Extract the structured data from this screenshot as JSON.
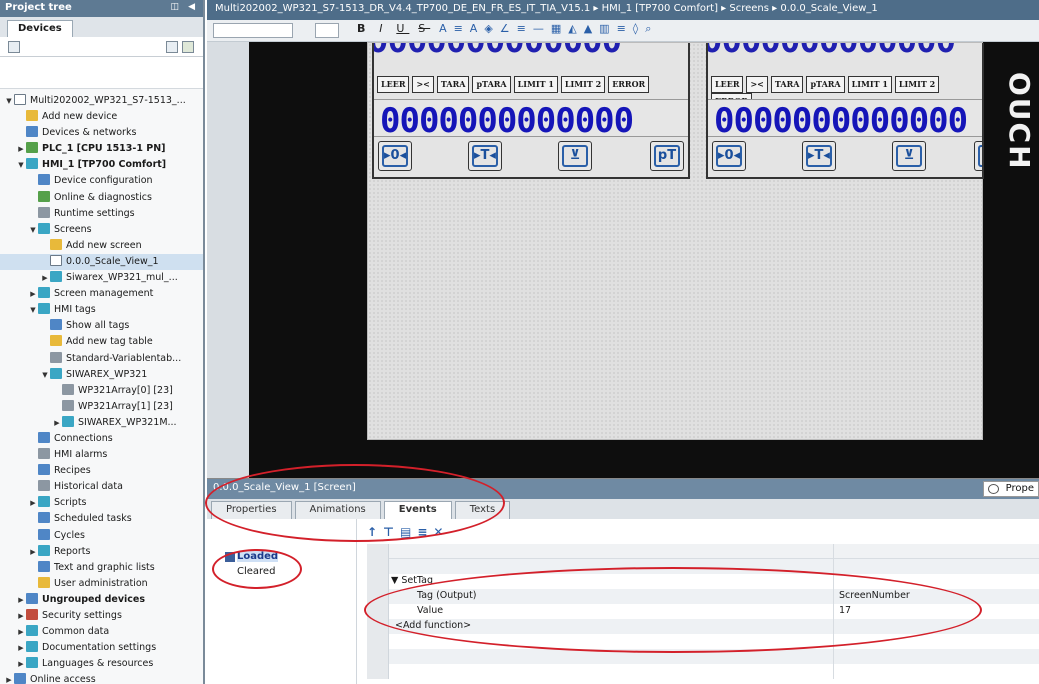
{
  "project_tree": {
    "title": "Project tree",
    "devices_tab": "Devices",
    "items": [
      {
        "label": "Multi202002_WP321_S7-1513_...",
        "indent": 0,
        "arrow": "▼",
        "icon": "doc"
      },
      {
        "label": "Add new device",
        "indent": 1,
        "arrow": "",
        "icon": "yel"
      },
      {
        "label": "Devices & networks",
        "indent": 1,
        "arrow": "",
        "icon": "blu"
      },
      {
        "label": "PLC_1 [CPU 1513-1 PN]",
        "indent": 1,
        "arrow": "▶",
        "icon": "grn",
        "bold": true
      },
      {
        "label": "HMI_1 [TP700 Comfort]",
        "indent": 1,
        "arrow": "▼",
        "icon": "cyn",
        "bold": true
      },
      {
        "label": "Device configuration",
        "indent": 2,
        "arrow": "",
        "icon": "blu"
      },
      {
        "label": "Online & diagnostics",
        "indent": 2,
        "arrow": "",
        "icon": "grn"
      },
      {
        "label": "Runtime settings",
        "indent": 2,
        "arrow": "",
        "icon": "gry"
      },
      {
        "label": "Screens",
        "indent": 2,
        "arrow": "▼",
        "icon": "cyn"
      },
      {
        "label": "Add new screen",
        "indent": 3,
        "arrow": "",
        "icon": "yel"
      },
      {
        "label": "0.0.0_Scale_View_1",
        "indent": 3,
        "arrow": "",
        "icon": "doc",
        "selected": true
      },
      {
        "label": "Siwarex_WP321_mul_...",
        "indent": 3,
        "arrow": "▶",
        "icon": "cyn"
      },
      {
        "label": "Screen management",
        "indent": 2,
        "arrow": "▶",
        "icon": "cyn"
      },
      {
        "label": "HMI tags",
        "indent": 2,
        "arrow": "▼",
        "icon": "cyn"
      },
      {
        "label": "Show all tags",
        "indent": 3,
        "arrow": "",
        "icon": "blu"
      },
      {
        "label": "Add new tag table",
        "indent": 3,
        "arrow": "",
        "icon": "yel"
      },
      {
        "label": "Standard-Variablentab...",
        "indent": 3,
        "arrow": "",
        "icon": "gry"
      },
      {
        "label": "SIWAREX_WP321",
        "indent": 3,
        "arrow": "▼",
        "icon": "cyn"
      },
      {
        "label": "WP321Array[0] [23]",
        "indent": 4,
        "arrow": "",
        "icon": "gry"
      },
      {
        "label": "WP321Array[1] [23]",
        "indent": 4,
        "arrow": "",
        "icon": "gry"
      },
      {
        "label": "SIWAREX_WP321M...",
        "indent": 4,
        "arrow": "▶",
        "icon": "cyn"
      },
      {
        "label": "Connections",
        "indent": 2,
        "arrow": "",
        "icon": "blu"
      },
      {
        "label": "HMI alarms",
        "indent": 2,
        "arrow": "",
        "icon": "gry"
      },
      {
        "label": "Recipes",
        "indent": 2,
        "arrow": "",
        "icon": "blu"
      },
      {
        "label": "Historical data",
        "indent": 2,
        "arrow": "",
        "icon": "gry"
      },
      {
        "label": "Scripts",
        "indent": 2,
        "arrow": "▶",
        "icon": "cyn"
      },
      {
        "label": "Scheduled tasks",
        "indent": 2,
        "arrow": "",
        "icon": "blu"
      },
      {
        "label": "Cycles",
        "indent": 2,
        "arrow": "",
        "icon": "blu"
      },
      {
        "label": "Reports",
        "indent": 2,
        "arrow": "▶",
        "icon": "cyn"
      },
      {
        "label": "Text and graphic lists",
        "indent": 2,
        "arrow": "",
        "icon": "blu"
      },
      {
        "label": "User administration",
        "indent": 2,
        "arrow": "",
        "icon": "yel"
      },
      {
        "label": "Ungrouped devices",
        "indent": 1,
        "arrow": "▶",
        "icon": "blu",
        "bold": true
      },
      {
        "label": "Security settings",
        "indent": 1,
        "arrow": "▶",
        "icon": "red"
      },
      {
        "label": "Common data",
        "indent": 1,
        "arrow": "▶",
        "icon": "cyn"
      },
      {
        "label": "Documentation settings",
        "indent": 1,
        "arrow": "▶",
        "icon": "cyn"
      },
      {
        "label": "Languages & resources",
        "indent": 1,
        "arrow": "▶",
        "icon": "cyn"
      },
      {
        "label": "Online access",
        "indent": 0,
        "arrow": "▶",
        "icon": "blu"
      }
    ]
  },
  "breadcrumb": "Multi202002_WP321_S7-1513_DR_V4.4_TP700_DE_EN_FR_ES_IT_TIA_V15.1 ▸ HMI_1 [TP700 Comfort] ▸ Screens ▸ 0.0.0_Scale_View_1",
  "format_toolbar": {
    "bold": "B",
    "italic": "I",
    "underline": "U",
    "strike": "S"
  },
  "faceplate": {
    "buttons": [
      "LEER",
      "><",
      "TARA",
      "pTARA",
      "LIMIT 1",
      "LIMIT 2",
      "ERROR"
    ],
    "zeros": "0000000000000",
    "icons": [
      "▸0◂",
      "▸T◂",
      "⊻",
      "pT"
    ]
  },
  "vertical_text": "OUCH",
  "properties": {
    "header": "0.0.0_Scale_View_1 [Screen]",
    "properties_button": "Prope",
    "tabs": [
      "Properties",
      "Animations",
      "Events",
      "Texts"
    ],
    "active_tab": "Events",
    "events": [
      "Loaded",
      "Cleared"
    ],
    "selected_event": "Loaded",
    "function_name": "SetTag",
    "rows": [
      {
        "name": "Tag (Output)",
        "value": "ScreenNumber"
      },
      {
        "name": "Value",
        "value": "17"
      }
    ],
    "add_function": "<Add function>"
  },
  "colors": {
    "annotation": "#d3202a",
    "title_bar": "#5e7a93",
    "zeros": "#1515b8"
  }
}
